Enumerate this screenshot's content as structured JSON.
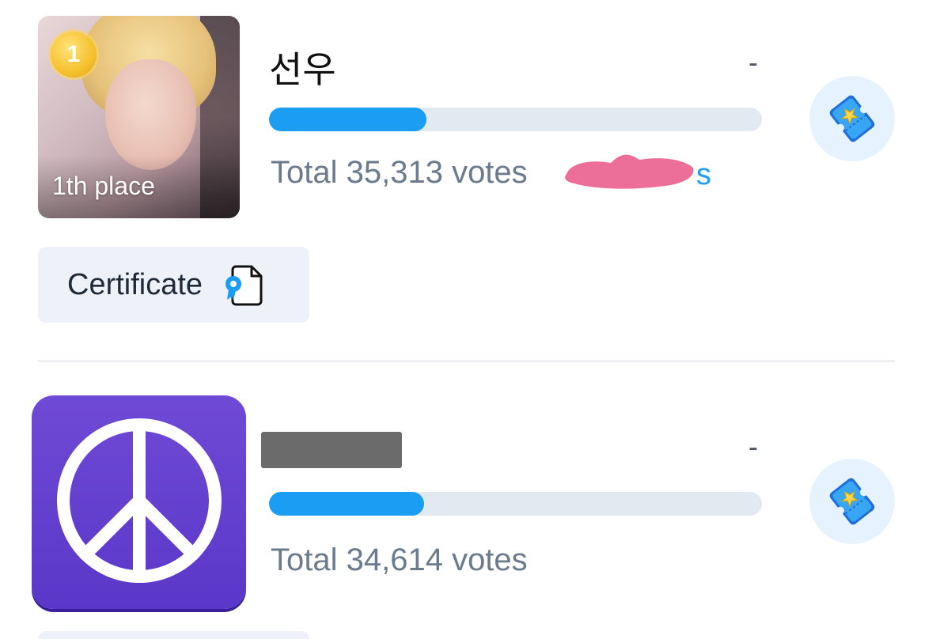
{
  "entries": [
    {
      "rank_badge": "1",
      "place_label": "1th place",
      "name": "선우",
      "rank_change": "-",
      "vote_fraction": 0.32,
      "votes_text": "Total 35,313 votes",
      "votes_link_suffix": "s",
      "certificate_label": "Certificate",
      "icons": {
        "vote": "vote-ticket-icon",
        "certificate": "certificate-document-icon",
        "medal": "gold-medal-icon"
      }
    },
    {
      "name_redacted": true,
      "rank_change": "-",
      "vote_fraction": 0.315,
      "votes_text": "Total 34,614 votes",
      "icons": {
        "avatar": "peace-sign-icon",
        "vote": "vote-ticket-icon"
      }
    }
  ],
  "colors": {
    "accent": "#1a9df3",
    "bar_track": "#e3e9f1",
    "vote_button_bg": "#e6f3ff",
    "certificate_bg": "#eef2f8",
    "app_icon_purple": "#6f4ad6",
    "redaction_pink": "#ec6f99",
    "redaction_gray": "#6b6b6b"
  }
}
